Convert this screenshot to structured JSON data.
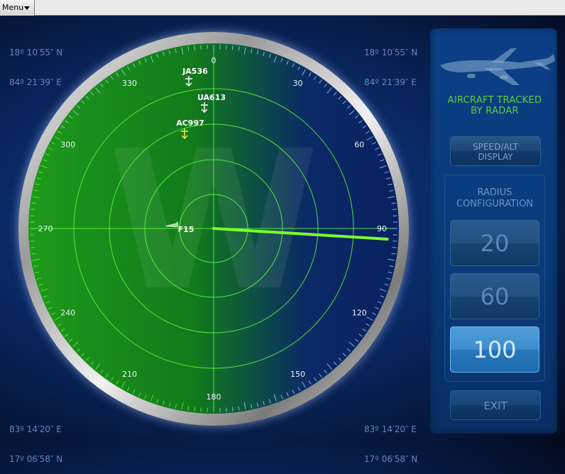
{
  "menu": {
    "label": "Menu"
  },
  "coords": {
    "top_left": [
      "18º 10′55″ N",
      "84º 21′39″ E"
    ],
    "top_right": [
      "18º 10′55″ N",
      "84º 21′39″ E"
    ],
    "bottom_left": [
      "83º 14′20″ E",
      "17º 06′58″ N"
    ],
    "bottom_right": [
      "83º 14′20″ E",
      "17º 06′58″ N"
    ]
  },
  "radar": {
    "bearing_labels": [
      "0",
      "30",
      "60",
      "90",
      "120",
      "150",
      "180",
      "210",
      "240",
      "270",
      "300",
      "330"
    ],
    "sweep_bearing_deg": 93.5,
    "aircraft": [
      {
        "callsign": "JA536",
        "color": "#ffffff",
        "heading": "down"
      },
      {
        "callsign": "UA613",
        "color": "#ffffff",
        "heading": "down"
      },
      {
        "callsign": "AC997",
        "color": "#ffee44",
        "heading": "down"
      },
      {
        "callsign": "F15",
        "color": "#ffffff",
        "heading": "left"
      }
    ],
    "colors": {
      "scope": "#1a8a1a",
      "grid": "#5cff3a",
      "sweep": "#7cff2a"
    }
  },
  "panel": {
    "title_line1": "AIRCRAFT TRACKED",
    "title_line2": "BY RADAR",
    "speed_line1": "SPEED/ALT",
    "speed_line2": "DISPLAY",
    "radius_line1": "RADIUS",
    "radius_line2": "CONFIGURATION",
    "radius_options": [
      "20",
      "60",
      "100"
    ],
    "radius_selected": "100",
    "exit_label": "EXIT"
  }
}
